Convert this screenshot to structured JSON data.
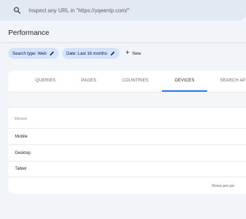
{
  "search": {
    "placeholder": "Inspect any URL in \"https://yqeentp.com/\"",
    "icon": "search-icon"
  },
  "page": {
    "title": "Performance"
  },
  "filters": {
    "chips": [
      {
        "label": "Search type: Web",
        "icon": "edit-icon"
      },
      {
        "label": "Date: Last 16 months",
        "icon": "edit-icon"
      }
    ],
    "new_label": "New"
  },
  "tabs": [
    {
      "label": "QUERIES",
      "active": false
    },
    {
      "label": "PAGES",
      "active": false
    },
    {
      "label": "COUNTRIES",
      "active": false
    },
    {
      "label": "DEVICES",
      "active": true
    },
    {
      "label": "SEARCH AP",
      "active": false
    }
  ],
  "table": {
    "column_header": "Device",
    "rows": [
      "Mobile",
      "Desktop",
      "Tablet"
    ]
  },
  "pagination": {
    "rows_per_page_label": "Rows per pa"
  },
  "colors": {
    "accent": "#1a73e8",
    "chip_bg": "#d3e3fd",
    "page_bg": "#f1f4f9"
  }
}
